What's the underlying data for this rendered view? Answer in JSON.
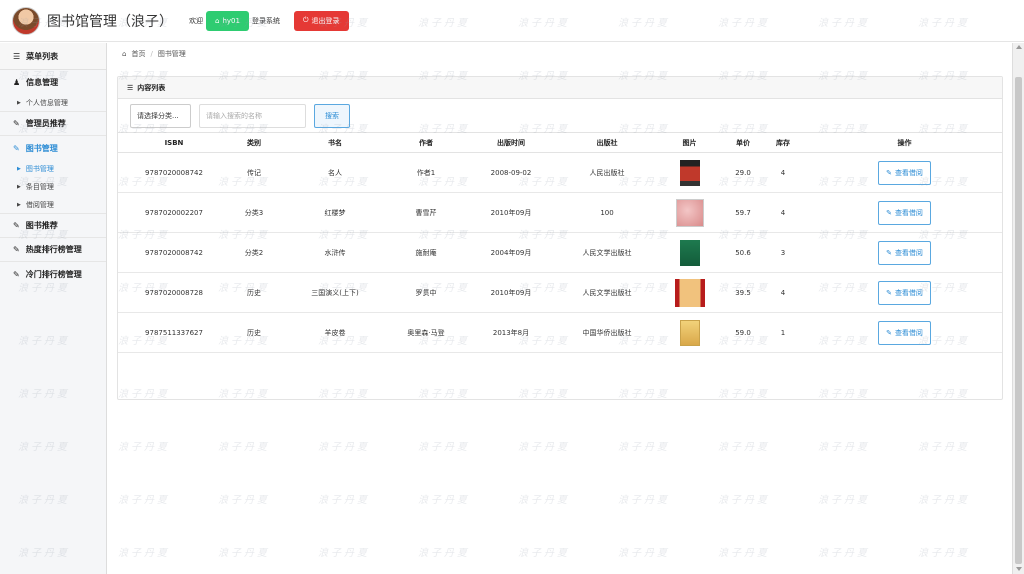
{
  "header": {
    "title": "图书馆管理（浪子）",
    "welcome": "欢迎",
    "user": "hy01",
    "login_system": "登录系统",
    "logout": "退出登录"
  },
  "sidebar": {
    "title": "菜单列表",
    "groups": [
      {
        "label": "信息管理",
        "icon": "user-icon"
      },
      {
        "label": "个人信息管理",
        "icon": "triangle-right-icon"
      },
      {
        "label": "管理员推荐",
        "icon": "edit-icon"
      },
      {
        "label": "图书管理",
        "icon": "edit-icon"
      },
      {
        "label": "图书管理",
        "icon": "triangle-right-icon"
      },
      {
        "label": "条目管理",
        "icon": "triangle-right-icon"
      },
      {
        "label": "借阅管理",
        "icon": "triangle-right-icon"
      },
      {
        "label": "图书推荐",
        "icon": "edit-icon"
      },
      {
        "label": "热度排行榜管理",
        "icon": "edit-icon"
      },
      {
        "label": "冷门排行榜管理",
        "icon": "edit-icon"
      }
    ]
  },
  "breadcrumb": {
    "home": "首页",
    "current": "图书管理"
  },
  "panel": {
    "title": "内容列表",
    "select_placeholder": "请选择分类...",
    "search_placeholder": "请输入搜索的名称",
    "search_button": "搜索"
  },
  "table": {
    "columns": [
      "ISBN",
      "类别",
      "书名",
      "作者",
      "出版时间",
      "出版社",
      "图片",
      "单价",
      "库存",
      "操作"
    ],
    "rows": [
      {
        "isbn": "9787020008742",
        "category": "传记",
        "title": "名人",
        "author": "作者1",
        "date": "2008-09-02",
        "publisher": "人民出版社",
        "price": "29.0",
        "stock": "4",
        "action": "查看借阅"
      },
      {
        "isbn": "9787020002207",
        "category": "分类3",
        "title": "红楼梦",
        "author": "曹雪芹",
        "date": "2010年09月",
        "publisher": "100",
        "price": "59.7",
        "stock": "4",
        "action": "查看借阅"
      },
      {
        "isbn": "9787020008742",
        "category": "分类2",
        "title": "水浒传",
        "author": "施耐庵",
        "date": "2004年09月",
        "publisher": "人民文学出版社",
        "price": "50.6",
        "stock": "3",
        "action": "查看借阅"
      },
      {
        "isbn": "9787020008728",
        "category": "历史",
        "title": "三国演义(上下)",
        "author": "罗贯中",
        "date": "2010年09月",
        "publisher": "人民文学出版社",
        "price": "39.5",
        "stock": "4",
        "action": "查看借阅"
      },
      {
        "isbn": "9787511337627",
        "category": "历史",
        "title": "羊皮卷",
        "author": "奥里森·马登",
        "date": "2013年8月",
        "publisher": "中国华侨出版社",
        "price": "59.0",
        "stock": "1",
        "action": "查看借阅"
      }
    ]
  },
  "watermark": "浪子丹夏",
  "colors": {
    "accent": "#2a8bd4",
    "user_btn": "#2ecc71",
    "logout_btn": "#e53935"
  }
}
